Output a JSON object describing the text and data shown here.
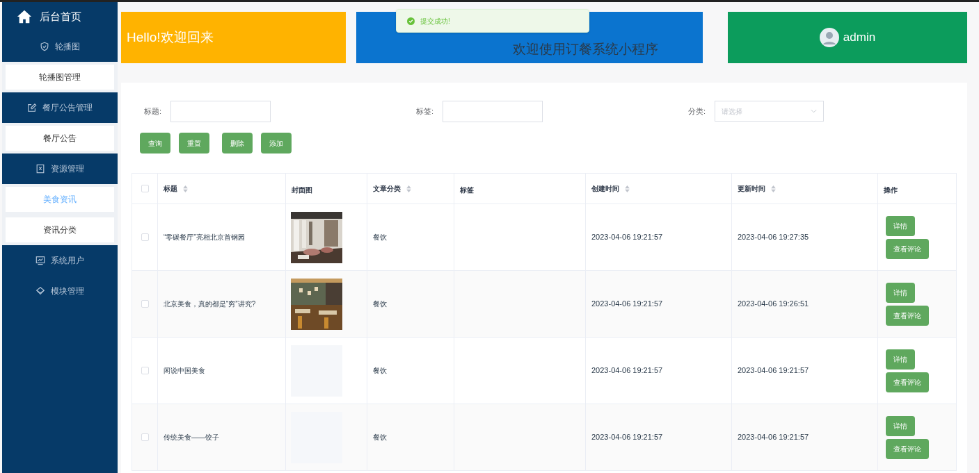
{
  "sidebar": {
    "home": "后台首页",
    "groups": [
      {
        "label": "轮播图",
        "children": [
          {
            "label": "轮播图管理",
            "selected": false
          }
        ]
      },
      {
        "label": "餐厅公告管理",
        "children": [
          {
            "label": "餐厅公告",
            "selected": false
          }
        ]
      },
      {
        "label": "资源管理",
        "children": [
          {
            "label": "美食资讯",
            "selected": true
          },
          {
            "label": "资讯分类",
            "selected": false
          }
        ]
      },
      {
        "label": "系统用户"
      },
      {
        "label": "模块管理"
      }
    ]
  },
  "banners": {
    "greeting": "Hello!欢迎回来",
    "welcome": "欢迎使用订餐系统小程序",
    "user": "admin"
  },
  "toast": {
    "text": "提交成功!"
  },
  "filters": [
    {
      "label": "标题:",
      "kind": "text"
    },
    {
      "label": "标签:",
      "kind": "text"
    },
    {
      "label": "分类:",
      "kind": "select",
      "placeholder": "请选择"
    }
  ],
  "buttons": [
    "查询",
    "重置",
    "删除",
    "添加"
  ],
  "table": {
    "header_checked": false,
    "columns": [
      {
        "label": "标题",
        "sortable": true
      },
      {
        "label": "封面图",
        "sortable": false
      },
      {
        "label": "文章分类",
        "sortable": true
      },
      {
        "label": "标签",
        "sortable": false
      },
      {
        "label": "创建时间",
        "sortable": true
      },
      {
        "label": "更新时间",
        "sortable": true
      },
      {
        "label": "操作",
        "sortable": false
      }
    ],
    "rows": [
      {
        "checked": false,
        "title": "“零碳餐厅”亮相北京首钢园",
        "cover": {
          "kind": "picture"
        },
        "category": "餐饮",
        "created": "2023-04-06 19:21:57",
        "updated": "2023-04-06 19:27:35",
        "actions": [
          "详情",
          "查看评论"
        ]
      },
      {
        "checked": false,
        "title": "北京美食，真的都是“穷”讲究?",
        "cover": {
          "kind": "picture"
        },
        "category": "餐饮",
        "created": "2023-04-06 19:21:57",
        "updated": "2023-04-06 19:26:51",
        "actions": [
          "详情",
          "查看评论"
        ]
      },
      {
        "checked": false,
        "title": "闲说中国美食",
        "category": "餐饮",
        "created": "2023-04-06 19:21:57",
        "updated": "2023-04-06 19:21:57",
        "actions": [
          "详情",
          "查看评论"
        ]
      },
      {
        "checked": false,
        "title": "传统美食——饺子",
        "category": "餐饮",
        "created": "2023-04-06 19:21:57",
        "updated": "2023-04-06 19:21:57",
        "actions": [
          "详情",
          "查看评论"
        ]
      }
    ]
  }
}
